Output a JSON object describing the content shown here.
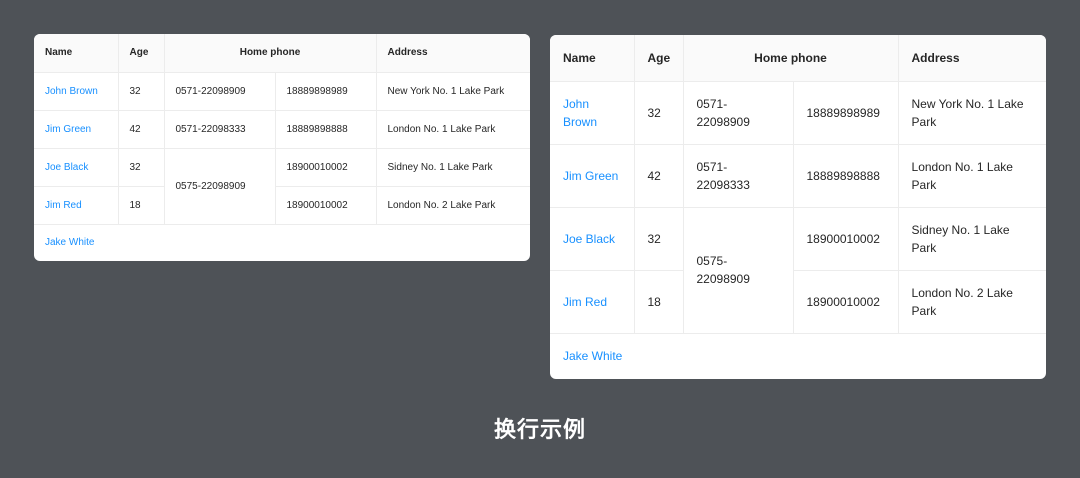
{
  "columns": {
    "name": "Name",
    "age": "Age",
    "home_phone": "Home phone",
    "address": "Address"
  },
  "rows": [
    {
      "name": "John Brown",
      "age": "32",
      "tel": "0571-22098909",
      "phone": "18889898989",
      "address": "New York No. 1 Lake Park"
    },
    {
      "name": "Jim Green",
      "age": "42",
      "tel": "0571-22098333",
      "phone": "18889898888",
      "address": "London No. 1 Lake Park"
    },
    {
      "name": "Joe Black",
      "age": "32",
      "tel": "0575-22098909",
      "phone": "18900010002",
      "address": "Sidney No. 1 Lake Park"
    },
    {
      "name": "Jim Red",
      "age": "18",
      "tel": "0575-22098909",
      "phone": "18900010002",
      "address": "London No. 2 Lake Park"
    },
    {
      "name": "Jake White"
    }
  ],
  "caption": "换行示例",
  "colors": {
    "background": "#4e5257",
    "link": "#1890ff",
    "header_bg": "#fafafa"
  }
}
